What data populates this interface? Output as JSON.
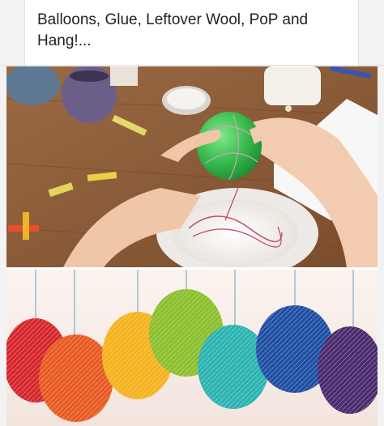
{
  "pin": {
    "description": "Balloons, Glue, Leftover Wool, PoP and Hang!..."
  },
  "photos": [
    {
      "icon": "craft-process-photo",
      "colors": {
        "table": "#8a5a36",
        "balloon": "#38c24d",
        "plate": "#f4f1ec",
        "yarn_spool": "#6a5e86"
      }
    },
    {
      "icon": "yarn-ball-lanterns-photo",
      "colors": [
        "#d5262b",
        "#e85a22",
        "#f4b21d",
        "#8bbf2d",
        "#2bb3b0",
        "#1f4fa3",
        "#4b2b6e"
      ]
    }
  ]
}
